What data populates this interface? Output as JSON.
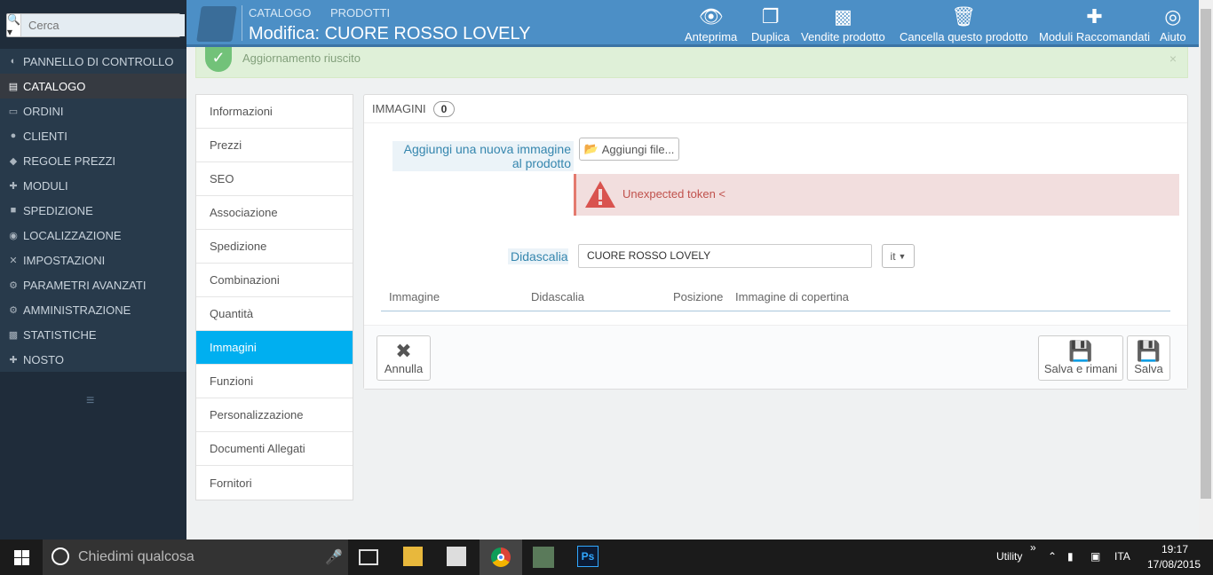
{
  "search": {
    "placeholder": "Cerca"
  },
  "nav": [
    {
      "label": "PANNELLO DI CONTROLLO",
      "icon": "dashboard-icon"
    },
    {
      "label": "CATALOGO",
      "icon": "book-icon"
    },
    {
      "label": "ORDINI",
      "icon": "credit-card-icon"
    },
    {
      "label": "CLIENTI",
      "icon": "users-icon"
    },
    {
      "label": "REGOLE PREZZI",
      "icon": "tags-icon"
    },
    {
      "label": "MODULI",
      "icon": "puzzle-icon"
    },
    {
      "label": "SPEDIZIONE",
      "icon": "truck-icon"
    },
    {
      "label": "LOCALIZZAZIONE",
      "icon": "globe-icon"
    },
    {
      "label": "IMPOSTAZIONI",
      "icon": "wrench-icon"
    },
    {
      "label": "PARAMETRI AVANZATI",
      "icon": "cogs-icon"
    },
    {
      "label": "AMMINISTRAZIONE",
      "icon": "cog-icon"
    },
    {
      "label": "STATISTICHE",
      "icon": "bar-chart-icon"
    },
    {
      "label": "NOSTO",
      "icon": "puzzle-icon"
    }
  ],
  "header": {
    "bc1": "CATALOGO",
    "bc2": "PRODOTTI",
    "title": "Modifica: CUORE ROSSO LOVELY",
    "toolbar": [
      "Anteprima",
      "Duplica",
      "Vendite prodotto",
      "Cancella questo prodotto",
      "Moduli Raccomandati",
      "Aiuto"
    ]
  },
  "success": {
    "message": "Aggiornamento riuscito"
  },
  "tabs": [
    "Informazioni",
    "Prezzi",
    "SEO",
    "Associazione",
    "Spedizione",
    "Combinazioni",
    "Quantità",
    "Immagini",
    "Funzioni",
    "Personalizzazione",
    "Documenti Allegati",
    "Fornitori"
  ],
  "panel": {
    "title": "IMMAGINI",
    "count": "0",
    "add_label": "Aggiungi una nuova immagine al prodotto",
    "add_button": "Aggiungi file...",
    "error": "Unexpected token <",
    "caption_label": "Didascalia",
    "caption_value": "CUORE ROSSO LOVELY",
    "lang": "it",
    "cols": [
      "Immagine",
      "Didascalia",
      "Posizione",
      "Immagine di copertina"
    ],
    "cancel": "Annulla",
    "save_stay": "Salva e rimani",
    "save": "Salva"
  },
  "taskbar": {
    "search": "Chiedimi qualcosa",
    "utility": "Utility",
    "lang": "ITA",
    "time": "19:17",
    "date": "17/08/2015"
  }
}
